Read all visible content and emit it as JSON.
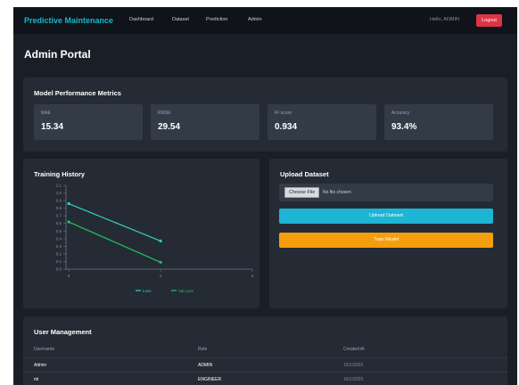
{
  "nav": {
    "brand": "Predictive Maintenance",
    "links": [
      "Dashboard",
      "Dataset",
      "Prediction",
      "Admin"
    ],
    "user_text": "Hello, ADMIN",
    "logout_label": "Logout"
  },
  "page": {
    "title": "Admin Portal"
  },
  "metrics": {
    "title": "Model Performance Metrics",
    "cards": [
      {
        "label": "MAE",
        "value": "15.34"
      },
      {
        "label": "RMSE",
        "value": "29.54"
      },
      {
        "label": "R² score",
        "value": "0.934"
      },
      {
        "label": "Accuracy",
        "value": "93.4%"
      }
    ]
  },
  "training": {
    "title": "Training History",
    "chart_data": {
      "type": "line",
      "x": [
        0,
        1
      ],
      "xlim": [
        -0.03,
        2
      ],
      "ylim": [
        0,
        1.1
      ],
      "yticks": [
        "0.0",
        "0.1",
        "0.2",
        "0.3",
        "0.4",
        "0.5",
        "0.6",
        "0.7",
        "0.8",
        "0.9",
        "1.0",
        "1.1"
      ],
      "xticks": [
        "0",
        "1",
        "2"
      ],
      "series": [
        {
          "values": [
            0.86,
            0.37
          ],
          "color": "#2dd4bf"
        },
        {
          "values": [
            0.62,
            0.09
          ],
          "color": "#22c55e"
        }
      ],
      "legend": [
        "Loss",
        "Val Loss"
      ],
      "legend_colors": [
        "#2dd4bf",
        "#22c55e"
      ]
    }
  },
  "upload": {
    "title": "Upload Dataset",
    "choose_label": "Choose File",
    "no_file_text": "No file chosen",
    "upload_label": "Upload Dataset",
    "train_label": "Train Model"
  },
  "users": {
    "title": "User Management",
    "headers": [
      "Username",
      "Role",
      "Created At"
    ],
    "rows": [
      {
        "username": "Admin",
        "role": "ADMIN",
        "created": "16/1/2025"
      },
      {
        "username": "ml",
        "role": "ENGINEER",
        "created": "16/1/2025"
      }
    ]
  }
}
